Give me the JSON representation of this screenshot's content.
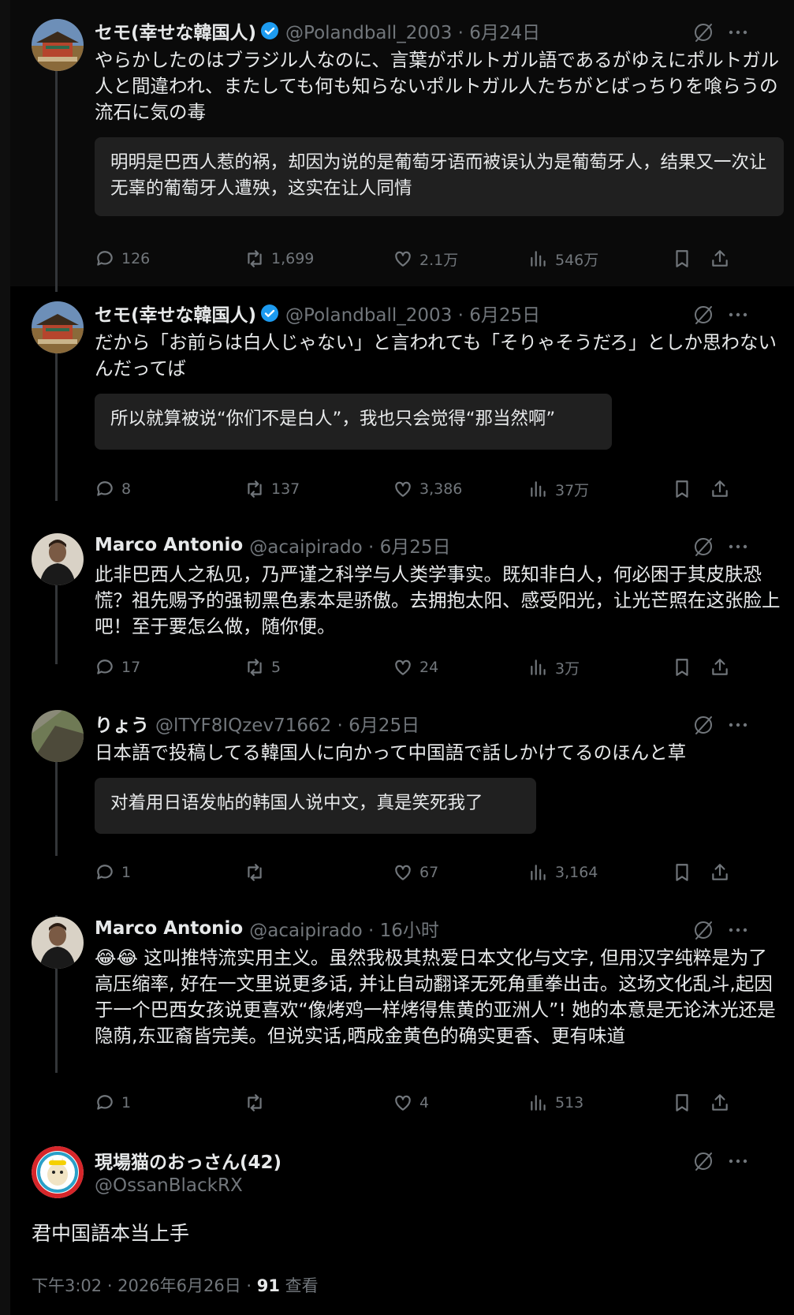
{
  "tweets": [
    {
      "name": "セモ(幸せな韓国人)",
      "verified": true,
      "handle_date": "@Polandball_2003 · 6月24日",
      "text": "やらかしたのはブラジル人なのに、言葉がポルトガル語であるがゆえにポルトガル人と間違われ、またしても何も知らないポルトガル人たちがとばっちりを喰らうの流石に気の毒",
      "translation": "明明是巴西人惹的祸，却因为说的是葡萄牙语而被误认为是葡萄牙人，结果又一次让无辜的葡萄牙人遭殃，这实在让人同情",
      "replies": "126",
      "retweets": "1,699",
      "likes": "2.1万",
      "views": "546万"
    },
    {
      "name": "セモ(幸せな韓国人)",
      "verified": true,
      "handle_date": "@Polandball_2003 · 6月25日",
      "text": "だから「お前らは白人じゃない」と言われても「そりゃそうだろ」としか思わないんだってば",
      "translation": "所以就算被说“你们不是白人”，我也只会觉得“那当然啊”",
      "replies": "8",
      "retweets": "137",
      "likes": "3,386",
      "views": "37万"
    },
    {
      "name": "Marco Antonio",
      "verified": false,
      "handle_date": "@acaipirado · 6月25日",
      "text": "此非巴西人之私见，乃严谨之科学与人类学事实。既知非白人，何必困于其皮肤恐慌？祖先赐予的强韧黑色素本是骄傲。去拥抱太阳、感受阳光，让光芒照在这张脸上吧！至于要怎么做，随你便。",
      "replies": "17",
      "retweets": "5",
      "likes": "24",
      "views": "3万"
    },
    {
      "name": "りょう",
      "verified": false,
      "handle_date": "@lTYF8IQzev71662 · 6月25日",
      "text": "日本語で投稿してる韓国人に向かって中国語で話しかけてるのほんと草",
      "translation": "对着用日语发帖的韩国人说中文，真是笑死我了",
      "replies": "1",
      "retweets": "",
      "likes": "67",
      "views": "3,164"
    },
    {
      "name": "Marco Antonio",
      "verified": false,
      "handle_date": "@acaipirado · 16小时",
      "text": "😂😂 这叫推特流实用主义。虽然我极其热爱日本文化与文字, 但用汉字纯粹是为了高压缩率, 好在一文里说更多话, 并让自动翻译无死角重拳出击。这场文化乱斗,起因于一个巴西女孩说更喜欢“像烤鸡一样烤得焦黄的亚洲人”! 她的本意是无论沐光还是隐荫,东亚裔皆完美。但说实话,晒成金黄色的确实更香、更有味道",
      "replies": "1",
      "retweets": "",
      "likes": "4",
      "views": "513"
    }
  ],
  "main": {
    "name": "現場猫のおっさん(42)",
    "handle": "@OssanBlackRX",
    "text": "君中国語本当上手",
    "time": "下午3:02 · 2026年6月26日 · ",
    "views_count": "91",
    "views_label": " 查看"
  },
  "icons": [
    "reply-icon",
    "retweet-icon",
    "like-icon",
    "views-icon",
    "bookmark-icon",
    "share-icon",
    "grok-icon",
    "more-icon",
    "verified-badge-icon"
  ],
  "colors": {
    "text": "#e7e9ea",
    "muted": "#71767b",
    "verified": "#1d9bf0",
    "background": "#000000",
    "translation_bg": "#202020"
  }
}
